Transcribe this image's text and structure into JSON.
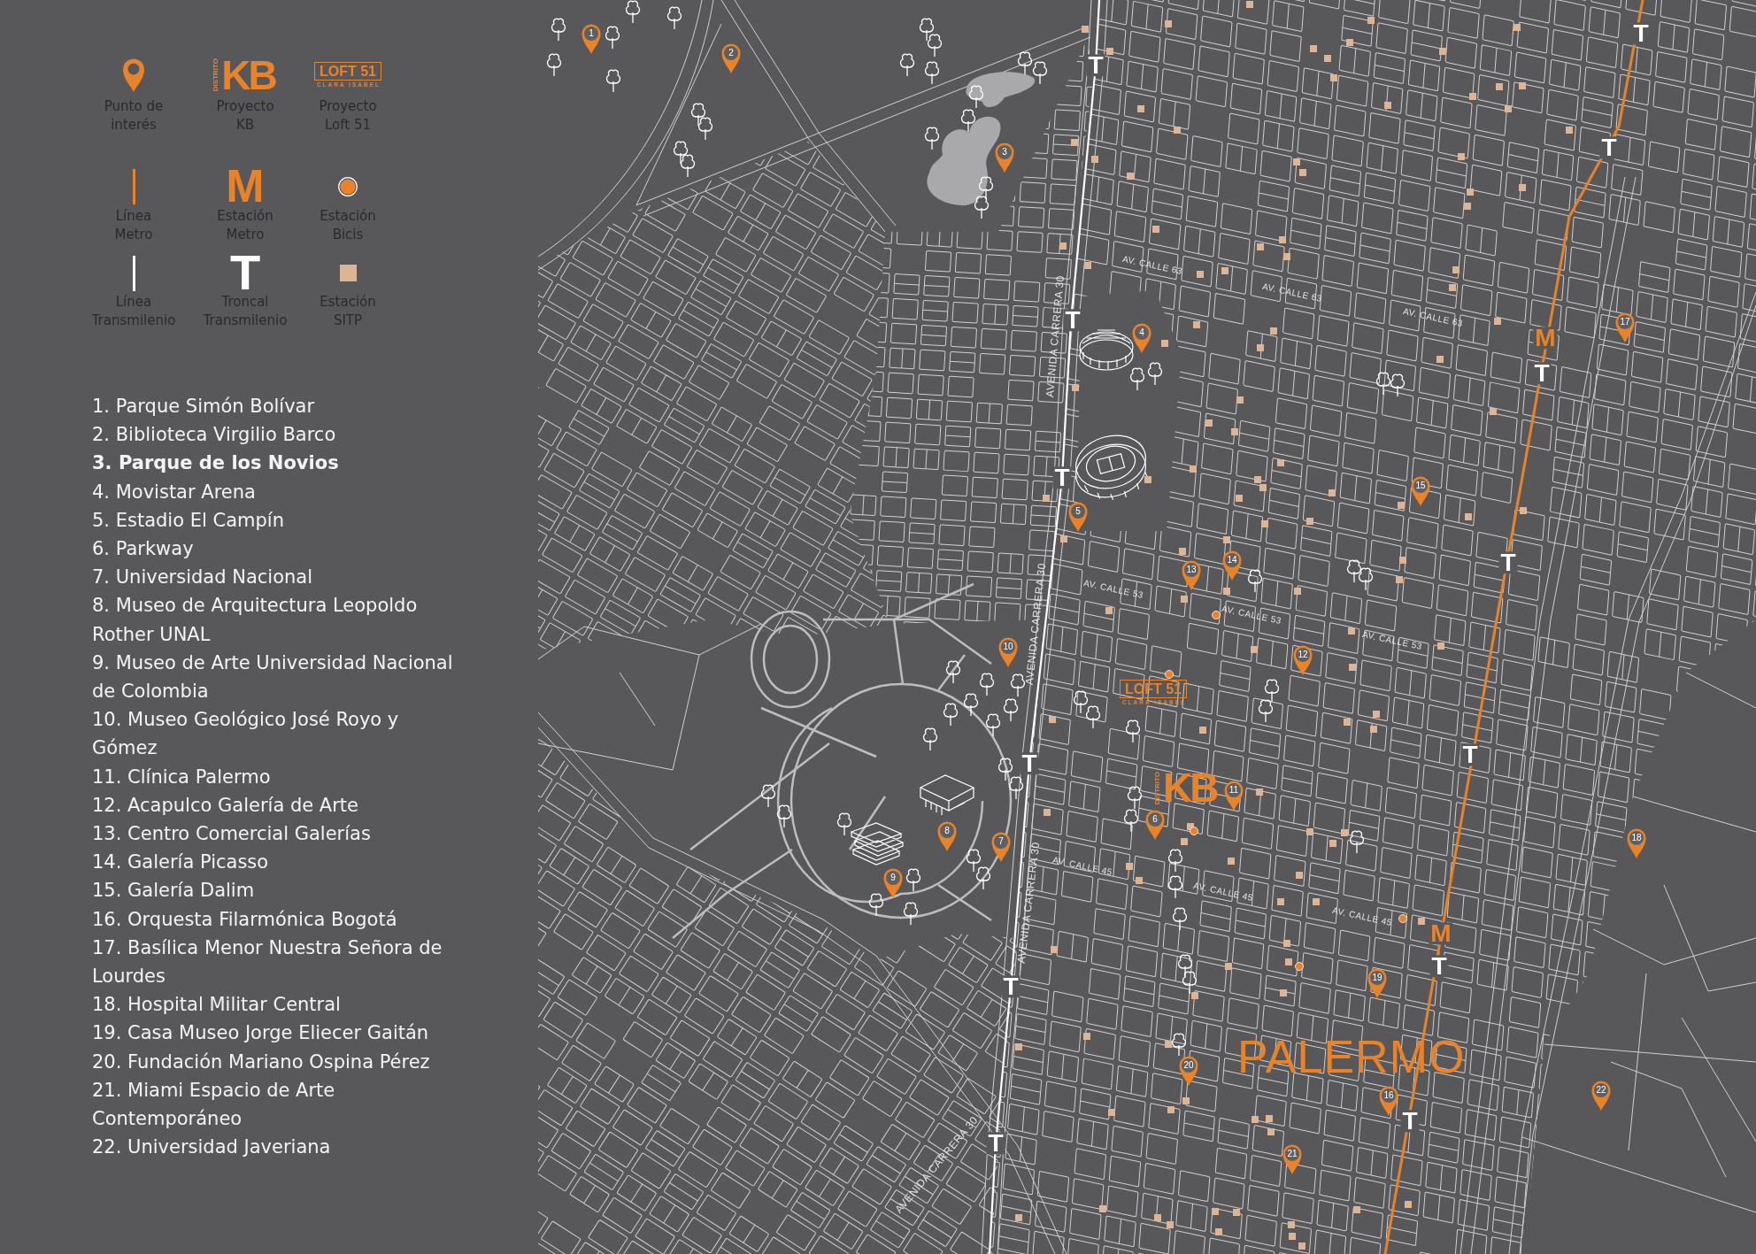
{
  "legend": {
    "items": [
      {
        "kind": "poi",
        "label": "Punto de\ninterés"
      },
      {
        "kind": "kb_logo",
        "label": "Proyecto\nKB",
        "logo": {
          "small": "DISTRITO",
          "main": "KB"
        }
      },
      {
        "kind": "loft_logo",
        "label": "Proyecto\nLoft 51",
        "logo": {
          "main": "LOFT 51",
          "sub": "CLARA ISABEL"
        }
      },
      {
        "kind": "metro_line",
        "label": "Línea\nMetro"
      },
      {
        "kind": "metro_station",
        "symbol": "M",
        "label": "Estación\nMetro"
      },
      {
        "kind": "bike_station",
        "label": "Estación\nBicis"
      },
      {
        "kind": "transmilenio_line",
        "label": "Línea\nTransmilenio"
      },
      {
        "kind": "troncal",
        "symbol": "T",
        "label": "Troncal\nTransmilenio"
      },
      {
        "kind": "sitp_station",
        "label": "Estación\nSITP"
      }
    ]
  },
  "places": [
    {
      "text": "1. Parque Simón Bolívar",
      "highlighted": false
    },
    {
      "text": "2. Biblioteca Virgilio Barco",
      "highlighted": false
    },
    {
      "text": "3. Parque de los Novios",
      "highlighted": true
    },
    {
      "text": "4. Movistar Arena",
      "highlighted": false
    },
    {
      "text": "5. Estadio El Campín",
      "highlighted": false
    },
    {
      "text": "6. Parkway",
      "highlighted": false
    },
    {
      "text": "7. Universidad Nacional",
      "highlighted": false
    },
    {
      "text": "8. Museo de Arquitectura Leopoldo Rother UNAL",
      "highlighted": false
    },
    {
      "text": "9. Museo de Arte Universidad Nacional de Colombia",
      "highlighted": false
    },
    {
      "text": "10. Museo Geológico José Royo y Gómez",
      "highlighted": false
    },
    {
      "text": "11. Clínica Palermo",
      "highlighted": false
    },
    {
      "text": "12. Acapulco Galería de Arte",
      "highlighted": false
    },
    {
      "text": "13. Centro Comercial Galerías",
      "highlighted": false
    },
    {
      "text": "14. Galería Picasso",
      "highlighted": false
    },
    {
      "text": "15. Galería Dalim",
      "highlighted": false
    },
    {
      "text": "16. Orquesta Filarmónica Bogotá",
      "highlighted": false
    },
    {
      "text": "17. Basílica Menor Nuestra Señora de Lourdes",
      "highlighted": false
    },
    {
      "text": "18. Hospital Militar Central",
      "highlighted": false
    },
    {
      "text": "19. Casa Museo Jorge Eliecer Gaitán",
      "highlighted": false
    },
    {
      "text": "20. Fundación Mariano Ospina Pérez",
      "highlighted": false
    },
    {
      "text": "21. Miami Espacio de Arte Contemporáneo",
      "highlighted": false
    },
    {
      "text": "22. Universidad Javeriana",
      "highlighted": false
    }
  ],
  "map": {
    "street_labels": [
      {
        "text": "AV. CALLE 63"
      },
      {
        "text": "AV. CALLE 63"
      },
      {
        "text": "AV. CALLE 63"
      },
      {
        "text": "AVENIDA CARRERA 30"
      },
      {
        "text": "AV. CALLE 53"
      },
      {
        "text": "AV. CALLE 53"
      },
      {
        "text": "AVENIDA CARRERA 30"
      },
      {
        "text": "AV. CALLE 53"
      },
      {
        "text": "AV. CALLE 45"
      },
      {
        "text": "AV. CALLE 45"
      },
      {
        "text": "AVENIDA CARRERA 30"
      },
      {
        "text": "AV. CALLE 45"
      },
      {
        "text": "AVENIDA CARRERA 30"
      }
    ],
    "stations": [
      {
        "kind": "troncal",
        "symbol": "T"
      },
      {
        "kind": "troncal",
        "symbol": "T"
      },
      {
        "kind": "troncal",
        "symbol": "T"
      },
      {
        "kind": "troncal",
        "symbol": "T"
      },
      {
        "kind": "metro",
        "symbol": "M"
      },
      {
        "kind": "troncal",
        "symbol": "T"
      },
      {
        "kind": "troncal",
        "symbol": "T"
      },
      {
        "kind": "troncal",
        "symbol": "T"
      },
      {
        "kind": "troncal",
        "symbol": "T"
      },
      {
        "kind": "troncal",
        "symbol": "T"
      },
      {
        "kind": "metro",
        "symbol": "M"
      },
      {
        "kind": "troncal",
        "symbol": "T"
      },
      {
        "kind": "troncal",
        "symbol": "T"
      },
      {
        "kind": "troncal",
        "symbol": "T"
      },
      {
        "kind": "troncal",
        "symbol": "T"
      }
    ],
    "pins": [
      {
        "number": "1"
      },
      {
        "number": "2"
      },
      {
        "number": "3"
      },
      {
        "number": "4"
      },
      {
        "number": "5"
      },
      {
        "number": "6"
      },
      {
        "number": "7"
      },
      {
        "number": "8"
      },
      {
        "number": "9"
      },
      {
        "number": "10"
      },
      {
        "number": "11"
      },
      {
        "number": "12"
      },
      {
        "number": "13"
      },
      {
        "number": "14"
      },
      {
        "number": "15"
      },
      {
        "number": "16"
      },
      {
        "number": "17"
      },
      {
        "number": "18"
      },
      {
        "number": "19"
      },
      {
        "number": "20"
      },
      {
        "number": "21"
      },
      {
        "number": "22"
      }
    ],
    "loft_logo": {
      "main": "LOFT 51",
      "sub": "CLARA ISABEL"
    },
    "kb_logo": {
      "small": "DISTRITO",
      "main": "KB"
    },
    "district_label": "PALERMO"
  }
}
